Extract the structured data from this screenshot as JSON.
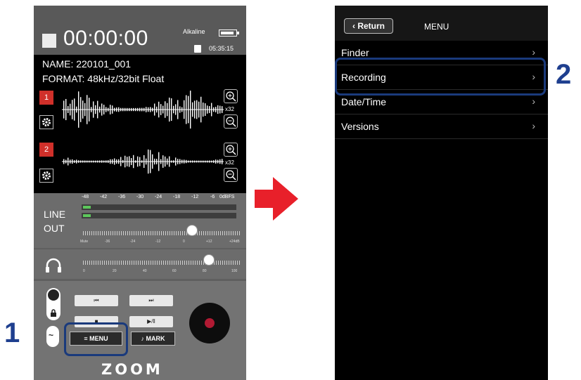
{
  "left_screen": {
    "time": "00:00:00",
    "battery_label": "Alkaline",
    "remaining": "05:35:15",
    "name_line": "NAME:  220101_001",
    "format_line": "FORMAT:   48kHz/32bit Float",
    "track1_label": "1",
    "track2_label": "2",
    "zoom_factor1": "x32",
    "zoom_factor2": "x32",
    "meter_scale": [
      "-48",
      "-42",
      "-36",
      "-30",
      "-24",
      "-18",
      "-12",
      "-6",
      "0dBFS"
    ],
    "line_label": "LINE",
    "out_label": "OUT",
    "gain_scale": [
      "Mute",
      "-36",
      "-24",
      "-12",
      "0",
      "+12",
      "+24dB"
    ],
    "hp_scale": [
      "0",
      "20",
      "40",
      "60",
      "80",
      "100"
    ],
    "menu_button": "MENU",
    "mark_button": "MARK",
    "brand": "ZOOM",
    "meter_levels": {
      "ch1": 0.05,
      "ch2": 0.05
    },
    "gain_knob_fraction": 0.69,
    "hp_volume": 80
  },
  "arrow_color": "#e8202a",
  "step_labels": {
    "step1": "1",
    "step2": "2"
  },
  "right_screen": {
    "return_label": "Return",
    "title": "MENU",
    "items": [
      {
        "label": "Finder"
      },
      {
        "label": "Recording"
      },
      {
        "label": "Date/Time"
      },
      {
        "label": "Versions"
      }
    ]
  },
  "colors": {
    "highlight": "#1a3a7c",
    "step_number": "#1f3f8f",
    "record": "#b11a33",
    "track": "#d0302a"
  }
}
